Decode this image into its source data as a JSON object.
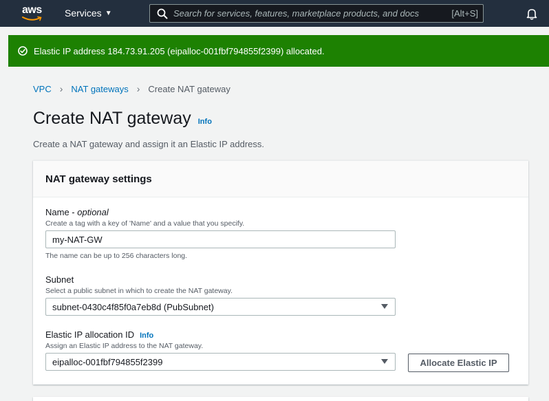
{
  "nav": {
    "logo_text": "aws",
    "services_label": "Services",
    "search_placeholder": "Search for services, features, marketplace products, and docs",
    "search_shortcut": "[Alt+S]"
  },
  "flash": {
    "message": "Elastic IP address 184.73.91.205 (eipalloc-001fbf794855f2399) allocated.",
    "color": "#1d8102"
  },
  "breadcrumb": {
    "items": [
      "VPC",
      "NAT gateways"
    ],
    "current": "Create NAT gateway"
  },
  "page": {
    "title": "Create NAT gateway",
    "info_label": "Info",
    "description": "Create a NAT gateway and assign it an Elastic IP address."
  },
  "settings": {
    "heading": "NAT gateway settings",
    "name_label": "Name - ",
    "name_optional": "optional",
    "name_hint": "Create a tag with a key of 'Name' and a value that you specify.",
    "name_value": "my-NAT-GW",
    "name_constraint": "The name can be up to 256 characters long.",
    "subnet_label": "Subnet",
    "subnet_hint": "Select a public subnet in which to create the NAT gateway.",
    "subnet_value": "subnet-0430c4f85f0a7eb8d (PubSubnet)",
    "eip_label": "Elastic IP allocation ID",
    "eip_info": "Info",
    "eip_hint": "Assign an Elastic IP address to the NAT gateway.",
    "eip_value": "eipalloc-001fbf794855f2399",
    "allocate_button": "Allocate Elastic IP"
  },
  "colors": {
    "nav_bg": "#232f3e",
    "link": "#0073bb",
    "success": "#1d8102"
  },
  "icons": [
    "aws-logo",
    "caret-down-icon",
    "search-icon",
    "bell-icon",
    "check-circle-icon",
    "chevron-right-icon",
    "dropdown-caret-icon"
  ]
}
